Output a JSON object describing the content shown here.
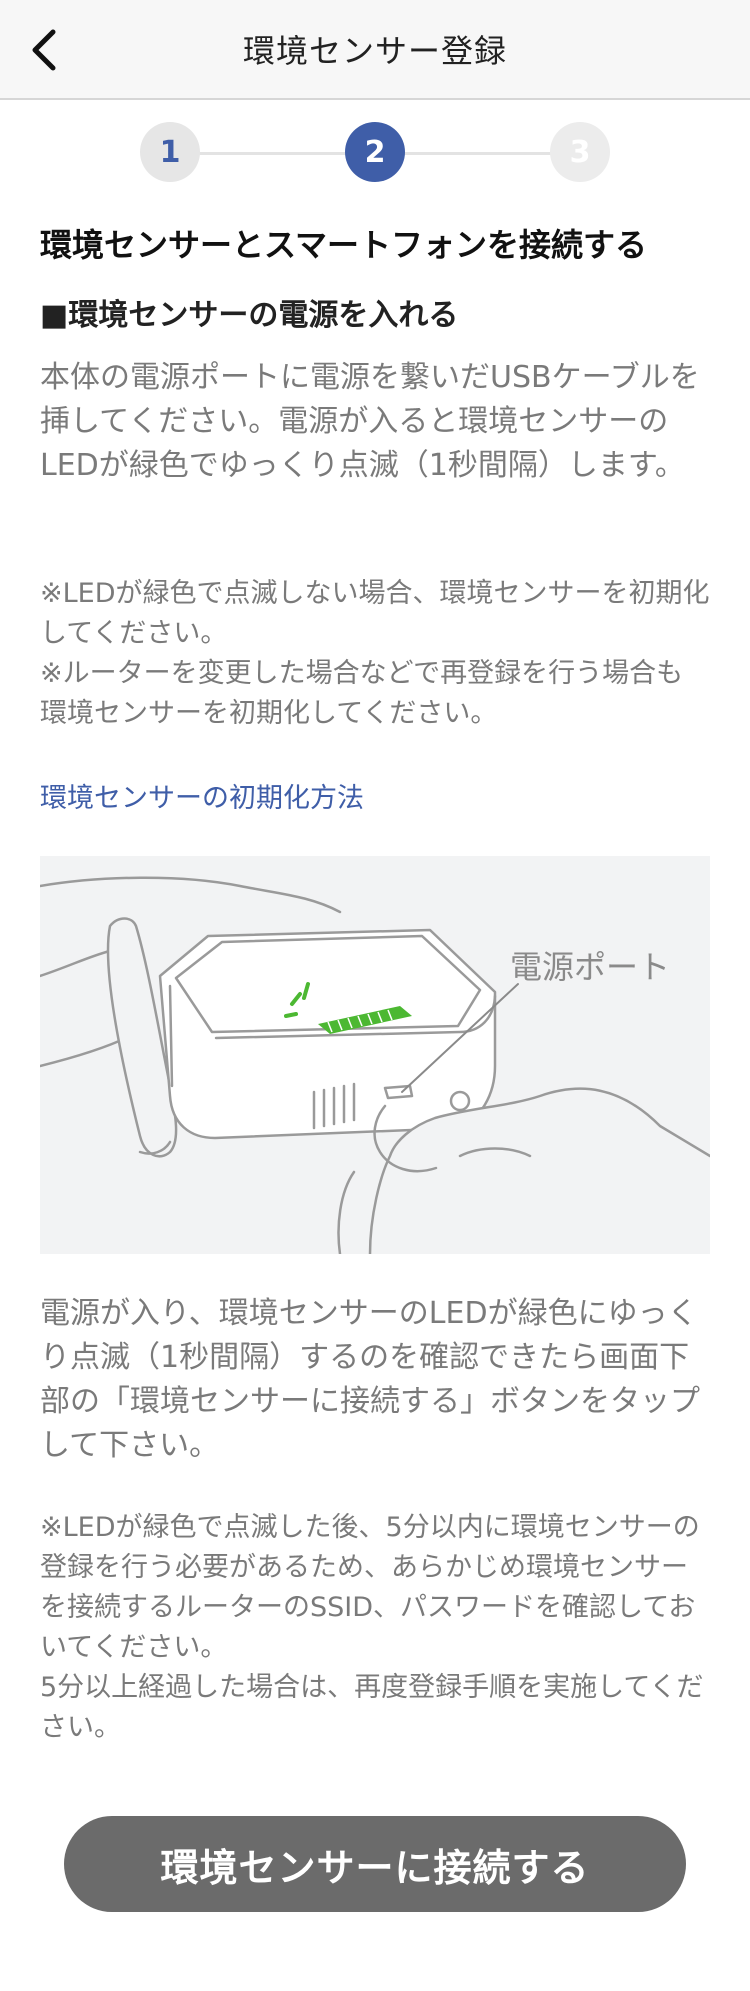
{
  "header": {
    "title": "環境センサー登録",
    "back_icon": "chevron-left-icon"
  },
  "stepper": {
    "steps": [
      {
        "label": "1",
        "state": "done"
      },
      {
        "label": "2",
        "state": "active"
      },
      {
        "label": "3",
        "state": "todo"
      }
    ],
    "current": 2,
    "accent": "#3f5ea8"
  },
  "main": {
    "heading": "環境センサーとスマートフォンを接続する",
    "subheading": "■環境センサーの電源を入れる",
    "instruction": "本体の電源ポートに電源を繋いだUSBケーブルを挿してください。電源が入ると環境センサーのLEDが緑色でゆっくり点滅（1秒間隔）します。",
    "notes": [
      "※LEDが緑色で点滅しない場合、環境センサーを初期化してください。",
      "※ルーターを変更した場合などで再登録を行う場合も環境センサーを初期化してください。"
    ],
    "reset_link": "環境センサーの初期化方法",
    "figure_label": "電源ポート",
    "confirm_text": "電源が入り、環境センサーのLEDが緑色にゆっくり点滅（1秒間隔）するのを確認できたら画面下部の「環境センサーに接続する」ボタンをタップして下さい。",
    "warning_1": "※LEDが緑色で点滅した後、5分以内に環境センサーの登録を行う必要があるため、あらかじめ環境センサーを接続するルーターのSSID、パスワードを確認しておいてください。",
    "warning_2": "5分以上経過した場合は、再度登録手順を実施してください。"
  },
  "footer": {
    "connect_button": "環境センサーに接続する",
    "button_color": "#6b6b6b"
  },
  "colors": {
    "link": "#3f5ea8",
    "led": "#4cb832"
  }
}
